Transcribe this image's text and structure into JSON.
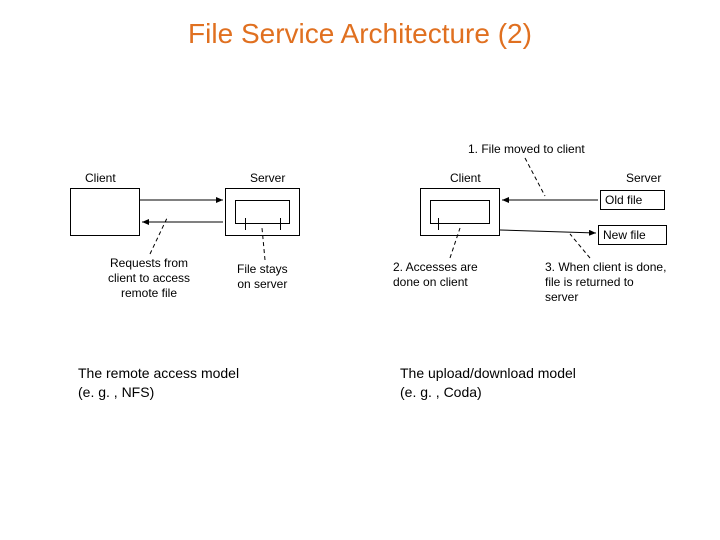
{
  "title": "File Service Architecture (2)",
  "left": {
    "client_label": "Client",
    "server_label": "Server",
    "note_left": "Requests from\nclient to access\nremote file",
    "note_right": "File stays\non server"
  },
  "right": {
    "client_label": "Client",
    "server_label": "Server",
    "old_file": "Old file",
    "new_file": "New file",
    "step1": "1. File moved to client",
    "step2": "2. Accesses are\ndone on client",
    "step3": "3. When client is done,\nfile is returned to\nserver"
  },
  "captions": {
    "left": "The remote access model\n(e. g. , NFS)",
    "right": "The upload/download model\n(e. g. , Coda)"
  }
}
